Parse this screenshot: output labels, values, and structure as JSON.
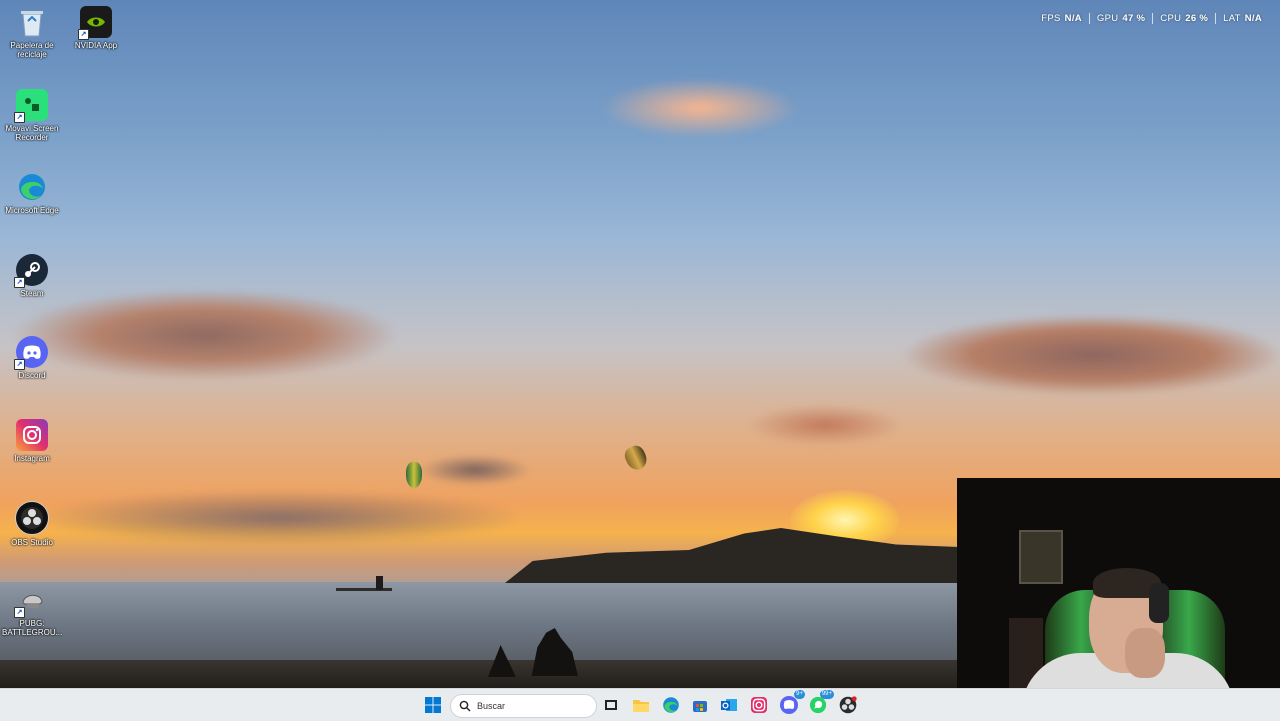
{
  "desktop": {
    "icons": [
      {
        "label": "Papelera de reciclaje",
        "icon": "recycle-bin-icon"
      },
      {
        "label": "NVIDIA App",
        "icon": "nvidia-icon"
      },
      {
        "label": "Movavi Screen Recorder",
        "icon": "movavi-icon"
      },
      {
        "label": "Microsoft Edge",
        "icon": "edge-icon"
      },
      {
        "label": "Steam",
        "icon": "steam-icon"
      },
      {
        "label": "Discord",
        "icon": "discord-icon"
      },
      {
        "label": "Instagram",
        "icon": "instagram-icon"
      },
      {
        "label": "OBS Studio",
        "icon": "obs-icon"
      },
      {
        "label": "PUBG: BATTLEGROU...",
        "icon": "pubg-icon"
      }
    ]
  },
  "perf_overlay": {
    "fps_label": "FPS",
    "fps_value": "N/A",
    "gpu_label": "GPU",
    "gpu_value": "47 %",
    "cpu_label": "CPU",
    "cpu_value": "26 %",
    "lat_label": "LAT",
    "lat_value": "N/A"
  },
  "taskbar": {
    "search_placeholder": "Buscar",
    "apps": [
      "start-icon",
      "task-view-icon",
      "file-explorer-icon",
      "edge-icon",
      "store-icon",
      "outlook-icon",
      "instagram-icon",
      "discord-icon",
      "whatsapp-icon",
      "obs-icon"
    ],
    "discord_badge": "9+",
    "whatsapp_badge": "99+"
  },
  "colors": {
    "taskbar_bg": "#e9ecef",
    "accent": "#0078d4"
  }
}
